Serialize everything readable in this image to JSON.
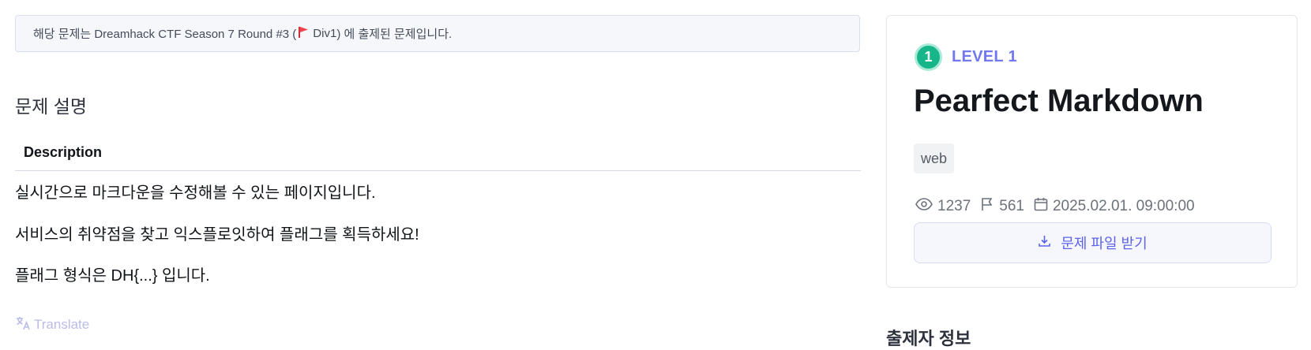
{
  "notice": {
    "prefix": "해당 문제는 Dreamhack CTF Season 7 Round #3 (",
    "flag_icon": "red-flag-icon",
    "division": "Div1",
    "suffix": ") 에 출제된 문제입니다."
  },
  "description": {
    "section_title": "문제 설명",
    "heading": "Description",
    "lines": [
      "실시간으로 마크다운을 수정해볼 수 있는 페이지입니다.",
      "서비스의 취약점을 찾고 익스플로잇하여 플래그를 획득하세요!",
      "플래그 형식은 DH{...} 입니다."
    ],
    "translate_label": "Translate",
    "translate_icon": "translate-icon"
  },
  "challenge": {
    "level_number": "1",
    "level_label": "LEVEL 1",
    "title": "Pearfect Markdown",
    "tag": "web",
    "views": "1237",
    "solves": "561",
    "date": "2025.02.01. 09:00:00",
    "download_label": "문제 파일 받기"
  },
  "author": {
    "section_title": "출제자 정보"
  },
  "colors": {
    "accent": "#5c63e8",
    "level_badge": "#17b58a",
    "level_text": "#7278ef"
  }
}
